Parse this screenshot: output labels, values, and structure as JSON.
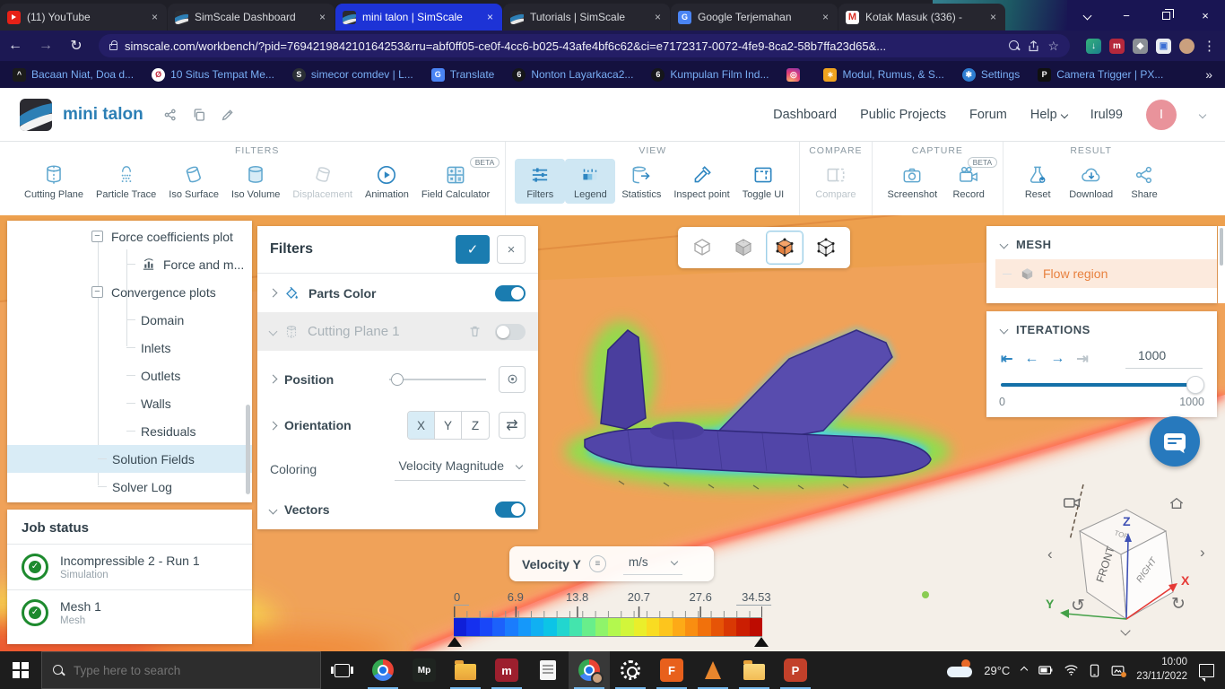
{
  "icons": {
    "close": "×",
    "check": "✓",
    "back": "←",
    "forward": "→",
    "refresh": "↻",
    "star": "☆",
    "overflow": "»",
    "dots": "⋮",
    "plus": "+",
    "minus": "−",
    "swap": "⇄",
    "hamburger": "≡",
    "rotate_left": "↺",
    "rotate_right": "↻",
    "chevron_left": "‹",
    "chevron_right": "›"
  },
  "colors": {
    "accent": "#1a7cb0",
    "ribbon_icon": "#5fa7cf",
    "selected_bg": "#cfe7f3",
    "viewport_orange": "#f0a259",
    "tree_highlight": "#d9ecf6",
    "active_tab": "#1d33d6",
    "flow_region_orange": "#e8813f",
    "status_green": "#1d8a2e"
  },
  "browser": {
    "tabs": [
      {
        "title": "(11) YouTube"
      },
      {
        "title": "SimScale Dashboard"
      },
      {
        "title": "mini talon | SimScale"
      },
      {
        "title": "Tutorials | SimScale"
      },
      {
        "title": "Google Terjemahan"
      },
      {
        "title": "Kotak Masuk (336) -"
      }
    ],
    "url": "simscale.com/workbench/?pid=769421984210164253&rru=abf0ff05-ce0f-4cc6-b025-43afe4bf6c62&ci=e7172317-0072-4fe9-8ca2-58b7ffa23d65&...",
    "bookmarks": [
      {
        "label": "Bacaan Niat, Doa d..."
      },
      {
        "label": "10 Situs Tempat Me..."
      },
      {
        "label": "simecor comdev | L..."
      },
      {
        "label": "Translate"
      },
      {
        "label": "Nonton Layarkaca2..."
      },
      {
        "label": "Kumpulan Film Ind..."
      },
      {
        "label": ""
      },
      {
        "label": "Modul, Rumus, & S..."
      },
      {
        "label": "Settings"
      },
      {
        "label": "Camera Trigger | PX..."
      }
    ]
  },
  "header": {
    "project": "mini talon",
    "nav": [
      "Dashboard",
      "Public Projects",
      "Forum"
    ],
    "help": "Help",
    "user": "Irul99",
    "avatar_initial": "I"
  },
  "ribbon": {
    "beta": "BETA",
    "groups": [
      {
        "title": "FILTERS",
        "items": [
          "Cutting Plane",
          "Particle Trace",
          "Iso Surface",
          "Iso Volume",
          "Displacement",
          "Animation",
          "Field Calculator"
        ]
      },
      {
        "title": "VIEW",
        "items": [
          "Filters",
          "Legend",
          "Statistics",
          "Inspect point",
          "Toggle UI"
        ]
      },
      {
        "title": "COMPARE",
        "items": [
          "Compare"
        ]
      },
      {
        "title": "CAPTURE",
        "items": [
          "Screenshot",
          "Record"
        ]
      },
      {
        "title": "RESULT",
        "items": [
          "Reset",
          "Download",
          "Share"
        ]
      }
    ]
  },
  "tree": {
    "items": [
      "Force coefficients plot",
      "Force and m...",
      "Convergence plots",
      "Domain",
      "Inlets",
      "Outlets",
      "Walls",
      "Residuals",
      "Solution Fields",
      "Solver Log"
    ]
  },
  "job_status": {
    "title": "Job status",
    "jobs": [
      {
        "name": "Incompressible 2 - Run 1",
        "type": "Simulation"
      },
      {
        "name": "Mesh 1",
        "type": "Mesh"
      }
    ]
  },
  "filters_panel": {
    "title": "Filters",
    "parts_color": "Parts Color",
    "cutting_plane": "Cutting Plane 1",
    "position": "Position",
    "orientation": "Orientation",
    "axes": [
      "X",
      "Y",
      "Z"
    ],
    "coloring_label": "Coloring",
    "coloring_value": "Velocity Magnitude",
    "vectors": "Vectors"
  },
  "mesh_panel": {
    "title": "MESH",
    "item": "Flow region"
  },
  "iterations_panel": {
    "title": "ITERATIONS",
    "value": "1000",
    "min": "0",
    "max": "1000"
  },
  "legend": {
    "field": "Velocity Y",
    "unit": "m/s",
    "ticks": [
      "0",
      "6.9",
      "13.8",
      "20.7",
      "27.6",
      "34.53"
    ],
    "colormap": [
      "#0f1fd8",
      "#1530ef",
      "#1947f8",
      "#1c61fb",
      "#1a7cfd",
      "#1598fa",
      "#10b0f2",
      "#0cc4e6",
      "#22d6cf",
      "#44e4ad",
      "#68ee8b",
      "#8ff46a",
      "#b3f84e",
      "#d2f63a",
      "#eaee2b",
      "#f9dc22",
      "#fdc51d",
      "#fdaa17",
      "#f98e11",
      "#f1710c",
      "#e65407",
      "#d93804",
      "#cb1e02",
      "#bd0b01"
    ]
  },
  "navcube": {
    "front": "FRONT",
    "right": "RIGHT",
    "top": "TOP",
    "x": "X",
    "y": "Y",
    "z": "Z"
  },
  "taskbar": {
    "search_placeholder": "Type here to search",
    "temp": "29°C",
    "time": "10:00",
    "date": "23/11/2022"
  }
}
